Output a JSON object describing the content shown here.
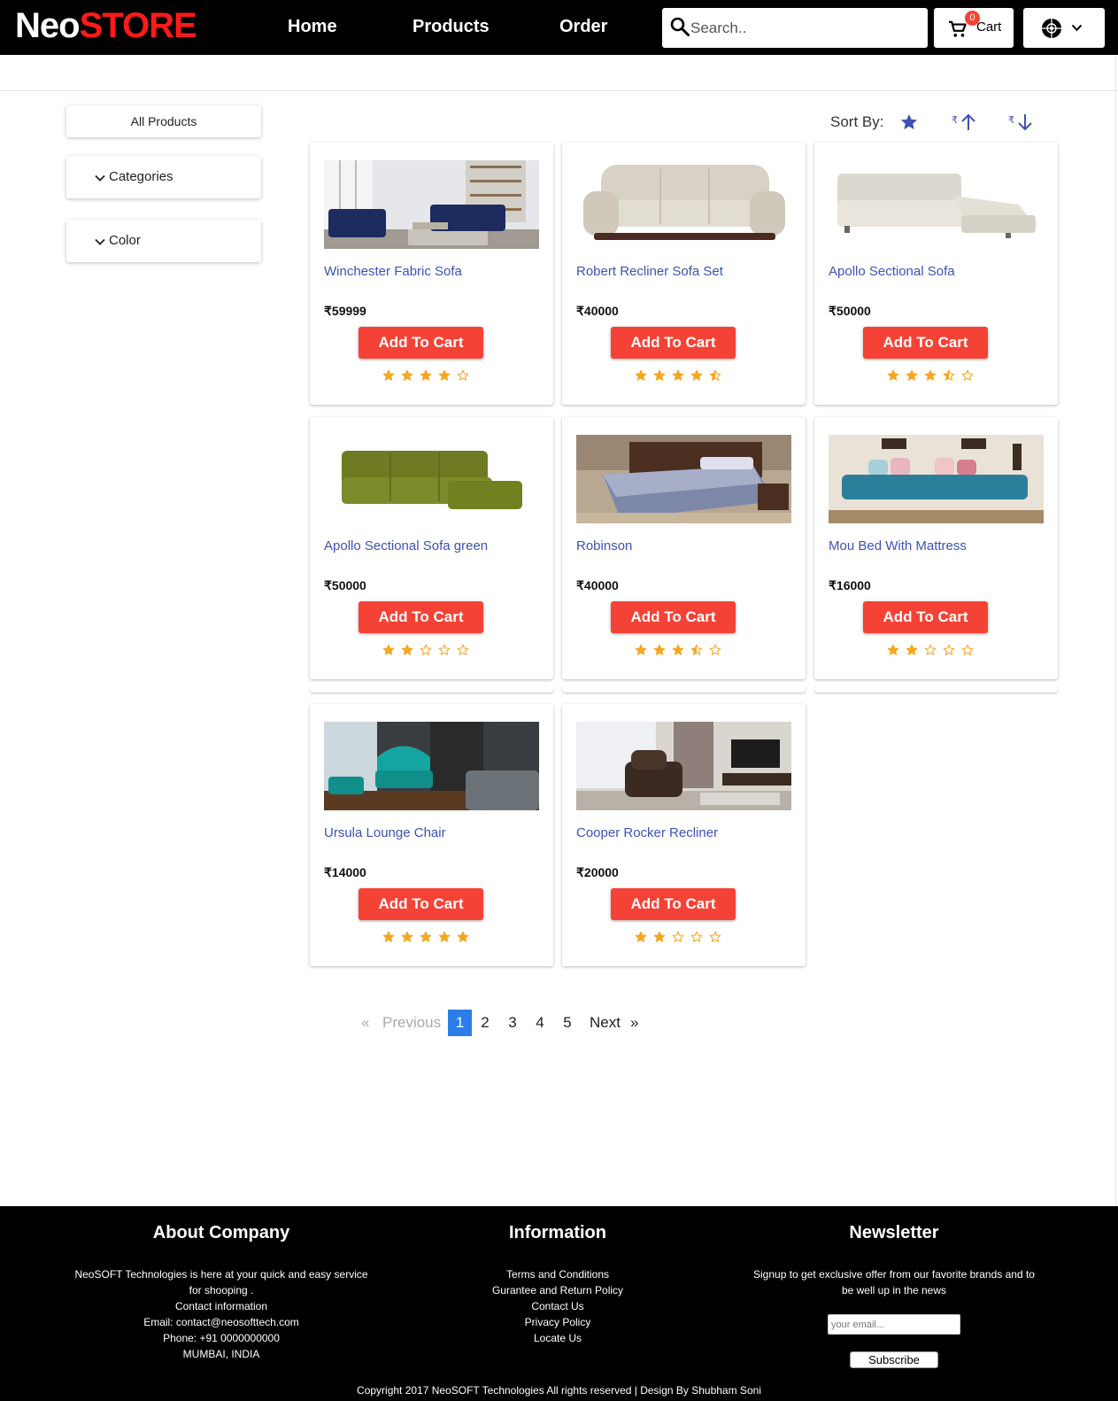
{
  "header": {
    "brand_part1": "Neo",
    "brand_part2": "STORE",
    "nav": [
      "Home",
      "Products",
      "Order"
    ],
    "search_placeholder": "Search..",
    "cart_label": "Cart",
    "cart_count": "0"
  },
  "sidebar": {
    "all_products": "All Products",
    "categories": "Categories",
    "color": "Color"
  },
  "sort": {
    "label": "Sort By:",
    "options": [
      "rating",
      "price-ascending",
      "price-descending"
    ]
  },
  "products": [
    {
      "name": "Winchester Fabric Sofa",
      "price": "₹59999",
      "button": "Add To Cart",
      "rating": 4
    },
    {
      "name": "Robert Recliner Sofa Set",
      "price": "₹40000",
      "button": "Add To Cart",
      "rating": 4.5
    },
    {
      "name": "Apollo Sectional Sofa",
      "price": "₹50000",
      "button": "Add To Cart",
      "rating": 3.5
    },
    {
      "name": "Apollo Sectional Sofa green",
      "price": "₹50000",
      "button": "Add To Cart",
      "rating": 2
    },
    {
      "name": "Robinson",
      "price": "₹40000",
      "button": "Add To Cart",
      "rating": 3.5
    },
    {
      "name": "Mou Bed With Mattress",
      "price": "₹16000",
      "button": "Add To Cart",
      "rating": 2
    },
    {
      "name": "Ursula Lounge Chair",
      "price": "₹14000",
      "button": "Add To Cart",
      "rating": 5
    },
    {
      "name": "Cooper Rocker Recliner",
      "price": "₹20000",
      "button": "Add To Cart",
      "rating": 2
    }
  ],
  "pagination": {
    "first_symbol": "«",
    "previous": "Previous",
    "pages": [
      "1",
      "2",
      "3",
      "4",
      "5"
    ],
    "current": "1",
    "next": "Next",
    "last_symbol": "»"
  },
  "footer": {
    "about": {
      "title": "About Company",
      "lines": [
        "NeoSOFT Technologies is here at your quick and easy service",
        "for shooping .",
        "Contact information",
        "Email: contact@neosofttech.com",
        "Phone: +91 0000000000",
        "MUMBAI, INDIA"
      ]
    },
    "information": {
      "title": "Information",
      "links": [
        "Terms and Conditions",
        "Gurantee and Return Policy",
        "Contact Us",
        "Privacy Policy",
        "Locate Us"
      ]
    },
    "newsletter": {
      "title": "Newsletter",
      "lines": [
        "Signup to get exclusive offer from our favorite brands and to",
        "be well up in the news"
      ],
      "email_placeholder": "your email...",
      "button": "Subscribe"
    },
    "copyright": "Copyright 2017 NeoSOFT Technologies All rights reserved | Design By Shubham Soni"
  },
  "colors": {
    "brand_red": "#ff1a1a",
    "add_button": "#f44336",
    "link_blue": "#3f51b5",
    "star": "#f5a623",
    "active_page": "#2b7de9"
  }
}
